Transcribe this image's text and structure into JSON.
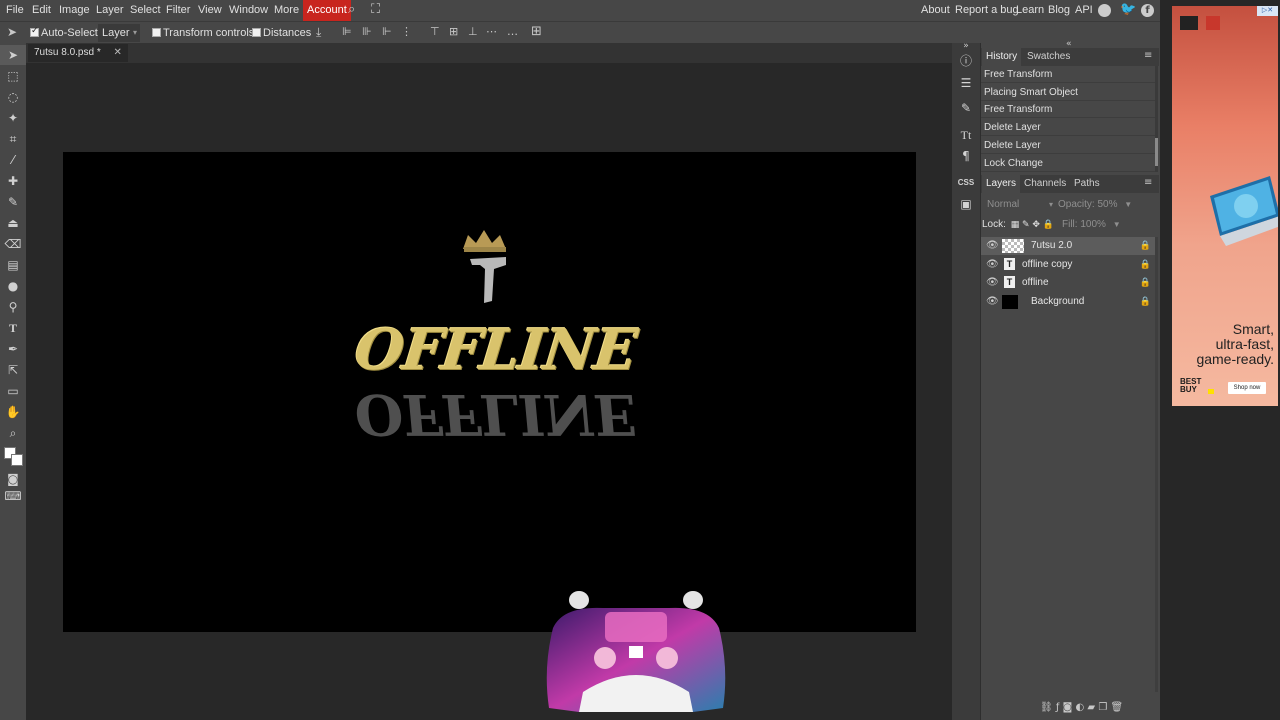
{
  "menu": {
    "items": [
      "File",
      "Edit",
      "Image",
      "Layer",
      "Select",
      "Filter",
      "View",
      "Window",
      "More",
      "Account"
    ],
    "right_items": [
      "About",
      "Report a bug",
      "Learn",
      "Blog",
      "API"
    ]
  },
  "options": {
    "auto_select_label": "Auto-Select",
    "auto_select_checked": true,
    "target_value": "Layer",
    "transform_controls_label": "Transform controls",
    "distances_label": "Distances"
  },
  "document": {
    "tab_title": "7utsu 8.0.psd *",
    "close_glyph": "✕"
  },
  "history": {
    "tabs": [
      "History",
      "Swatches"
    ],
    "items": [
      "Free Transform",
      "Placing Smart Object",
      "Free Transform",
      "Delete Layer",
      "Delete Layer",
      "Lock Change"
    ]
  },
  "layers": {
    "tabs": [
      "Layers",
      "Channels",
      "Paths"
    ],
    "blend_mode": "Normal",
    "opacity_label": "Opacity:",
    "opacity_value": "50%",
    "lock_label": "Lock:",
    "fill_label": "Fill:",
    "fill_value": "100%",
    "items": [
      {
        "name": "7utsu 2.0",
        "kind": "image",
        "selected": true
      },
      {
        "name": "offline copy",
        "kind": "text",
        "selected": false
      },
      {
        "name": "offline",
        "kind": "text",
        "selected": false
      },
      {
        "name": "Background",
        "kind": "fill",
        "selected": false
      }
    ]
  },
  "artwork": {
    "logo_numeral": "7",
    "word": "OFFLINE",
    "word_color": "#d9c36c",
    "reflection_color": "#6a6a6a",
    "crown_color": "#b89a55"
  },
  "ad": {
    "headline_lines": [
      "Smart,",
      "ultra-fast,",
      "game-ready."
    ],
    "brand_line1": "BEST",
    "brand_line2": "BUY",
    "cta": "Shop now"
  },
  "colors": {
    "account": "#c8251e",
    "panel_bg": "#474747",
    "canvas_bg": "#000000"
  }
}
